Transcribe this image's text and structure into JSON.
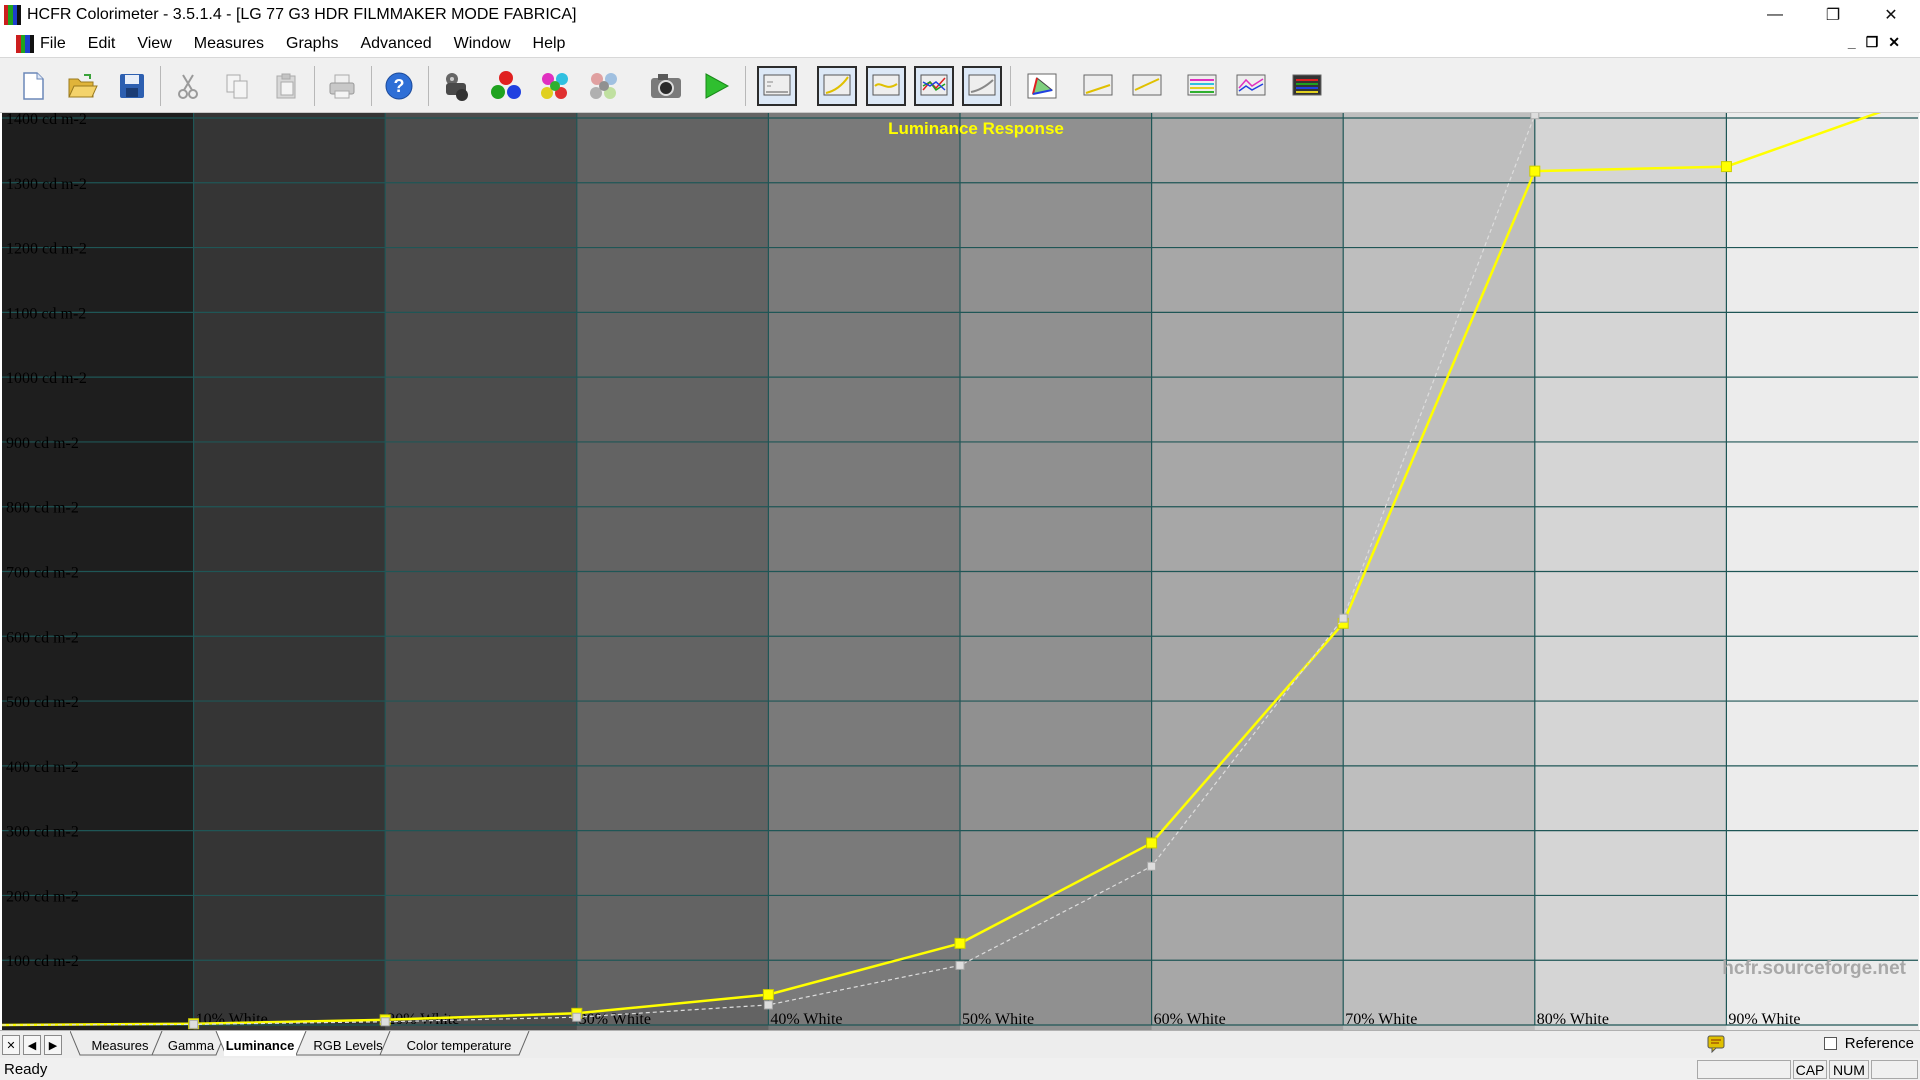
{
  "window": {
    "title": "HCFR Colorimeter - 3.5.1.4 - [LG 77 G3 HDR FILMMAKER MODE FABRICA]",
    "minimize": "—",
    "restore": "❐",
    "close": "✕"
  },
  "menu": {
    "items": [
      "File",
      "Edit",
      "View",
      "Measures",
      "Graphs",
      "Advanced",
      "Window",
      "Help"
    ],
    "mdi_minimize": "_",
    "mdi_restore": "❐",
    "mdi_close": "✕"
  },
  "toolbar": {
    "buttons": [
      {
        "icon": "new-document-icon"
      },
      {
        "icon": "open-folder-icon"
      },
      {
        "icon": "save-disk-icon"
      },
      {
        "icon": "cut-icon"
      },
      {
        "icon": "copy-icon"
      },
      {
        "icon": "paste-icon"
      },
      {
        "icon": "print-icon"
      },
      {
        "icon": "help-icon"
      },
      {
        "icon": "sensor-icon"
      },
      {
        "icon": "rgb-balls-icon"
      },
      {
        "icon": "color-balls-icon"
      },
      {
        "icon": "gray-balls-icon"
      },
      {
        "icon": "camera-icon"
      },
      {
        "icon": "play-icon"
      },
      {
        "icon": "graph-luminance-icon"
      },
      {
        "icon": "graph-gamma-icon"
      },
      {
        "icon": "graph-rgb-icon"
      },
      {
        "icon": "graph-colortemp-icon"
      },
      {
        "icon": "graph-cie-icon"
      },
      {
        "icon": "cie-diagram-icon"
      },
      {
        "icon": "graph-near-black-icon"
      },
      {
        "icon": "graph-near-white-icon"
      },
      {
        "icon": "graph-saturation-luma-icon"
      },
      {
        "icon": "graph-saturation-shift-icon"
      },
      {
        "icon": "graph-color-comparator-icon"
      }
    ]
  },
  "chart_data": {
    "type": "line",
    "title": "Luminance Response",
    "watermark": "hcfr.sourceforge.net",
    "y_unit_label": "cd m-2",
    "ylim": [
      0,
      1400
    ],
    "y_ticks": [
      100,
      200,
      300,
      400,
      500,
      600,
      700,
      800,
      900,
      1000,
      1100,
      1200,
      1300,
      1400
    ],
    "y_tick_labels": [
      "100 cd m-2",
      "200 cd m-2",
      "300 cd m-2",
      "400 cd m-2",
      "500 cd m-2",
      "600 cd m-2",
      "700 cd m-2",
      "800 cd m-2",
      "900 cd m-2",
      "1000 cd m-2",
      "1100 cd m-2",
      "1200 cd m-2",
      "1300 cd m-2",
      "1400 cd m-2"
    ],
    "x": [
      0,
      10,
      20,
      30,
      40,
      50,
      60,
      70,
      80,
      90,
      100
    ],
    "x_tick_labels": [
      "10% White",
      "20% White",
      "30% White",
      "40% White",
      "50% White",
      "60% White",
      "70% White",
      "80% White",
      "90% White"
    ],
    "grid": true,
    "background": "grayscale steps",
    "series": [
      {
        "role": "measured",
        "color": "#ffff00",
        "values": [
          0,
          2,
          8,
          18,
          47,
          126,
          281,
          620,
          1318,
          1325,
          1430
        ]
      },
      {
        "role": "reference",
        "color": "#dddddd",
        "dashed": true,
        "values": [
          0,
          1,
          5,
          12,
          31,
          92,
          245,
          628,
          1405,
          null,
          null
        ]
      }
    ]
  },
  "tabs": {
    "items": [
      "Measures",
      "Gamma",
      "Luminance",
      "RGB Levels",
      "Color temperature"
    ],
    "active": "Luminance",
    "nav_close": "✕",
    "nav_prev": "◀",
    "nav_next": "▶"
  },
  "reference": {
    "label": "Reference",
    "checked": false
  },
  "status": {
    "text": "Ready",
    "cap": "CAP",
    "num": "NUM"
  },
  "colors": {
    "graph_grid": "#1f5656",
    "curve": "#ffff00",
    "title": "#ffff00",
    "tick_label": "#000000"
  }
}
